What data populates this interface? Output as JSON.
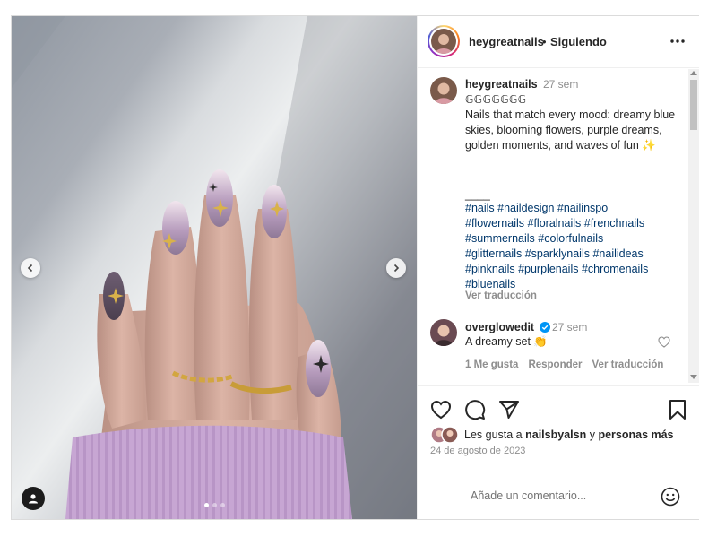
{
  "header": {
    "username": "heygreatnails",
    "separator": "•",
    "follow_status": "Siguiendo",
    "more_icon": "more-horizontal-icon"
  },
  "caption": {
    "username": "heygreatnails",
    "time": "27 sem",
    "symbols": "𝔾𝔾𝔾𝔾𝔾𝔾𝔾",
    "text": "Nails that match every mood: dreamy blue skies, blooming flowers, purple dreams, golden moments, and waves of fun ✨",
    "divider": "____",
    "hashtags": [
      "#nails",
      "#naildesign",
      "#nailinspo",
      "#flowernails",
      "#floralnails",
      "#frenchnails",
      "#summernails",
      "#colorfulnails",
      "#glitternails",
      "#sparklynails",
      "#nailideas",
      "#pinknails",
      "#purplenails",
      "#chromenails",
      "#bluenails"
    ],
    "translate": "Ver traducción"
  },
  "comment": {
    "username": "overglowedit",
    "verified": true,
    "time": "27 sem",
    "text": "A dreamy set 👏",
    "likes": "1 Me gusta",
    "reply": "Responder",
    "translate": "Ver traducción"
  },
  "actions": {
    "like_icon": "heart-icon",
    "comment_icon": "comment-icon",
    "share_icon": "send-icon",
    "save_icon": "bookmark-icon"
  },
  "likes": {
    "prefix": "Les gusta a",
    "user": "nailsbyalsn",
    "conjunction": "y",
    "others": "personas más"
  },
  "date": "24 de agosto de 2023",
  "comment_input": {
    "placeholder": "Añade un comentario..."
  },
  "carousel": {
    "total": 3,
    "current": 1
  },
  "colors": {
    "link": "#00376b",
    "muted": "#8e8e8e",
    "text": "#262626",
    "verified": "#0095f6"
  }
}
